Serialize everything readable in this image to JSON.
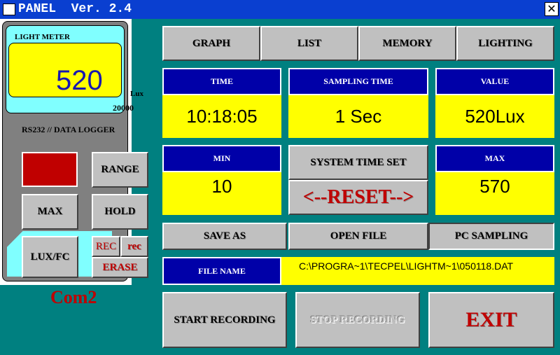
{
  "title": "PANEL  Ver. 2.4",
  "close": "✕",
  "meter": {
    "label": "LIGHT METER",
    "reading": "520",
    "unit": "Lux",
    "range": "20000",
    "subtitle": "RS232 // DATA LOGGER",
    "range_btn": "RANGE",
    "max_btn": "MAX",
    "hold_btn": "HOLD",
    "luxfc_btn": "LUX/FC",
    "rec_btn": "REC",
    "rec_small_btn": "rec",
    "erase_btn": "ERASE",
    "port": "Com2"
  },
  "tabs": [
    "GRAPH",
    "LIST",
    "MEMORY",
    "LIGHTING"
  ],
  "time": {
    "label": "TIME",
    "value": "10:18:05"
  },
  "sampling": {
    "label": "SAMPLING TIME",
    "value": "1 Sec"
  },
  "value": {
    "label": "VALUE",
    "value": "520Lux"
  },
  "min": {
    "label": "MIN",
    "value": "10"
  },
  "max": {
    "label": "MAX",
    "value": "570"
  },
  "system_time_set": "SYSTEM TIME SET",
  "reset": "<--RESET-->",
  "save_as": "SAVE AS",
  "open_file": "OPEN FILE",
  "pc_sampling": "PC SAMPLING",
  "file": {
    "label": "FILE NAME",
    "value": "C:\\PROGRA~1\\TECPEL\\LIGHTM~1\\050118.DAT"
  },
  "start_recording": "START RECORDING",
  "stop_recording": "STOP RECORDING",
  "exit": "EXIT"
}
